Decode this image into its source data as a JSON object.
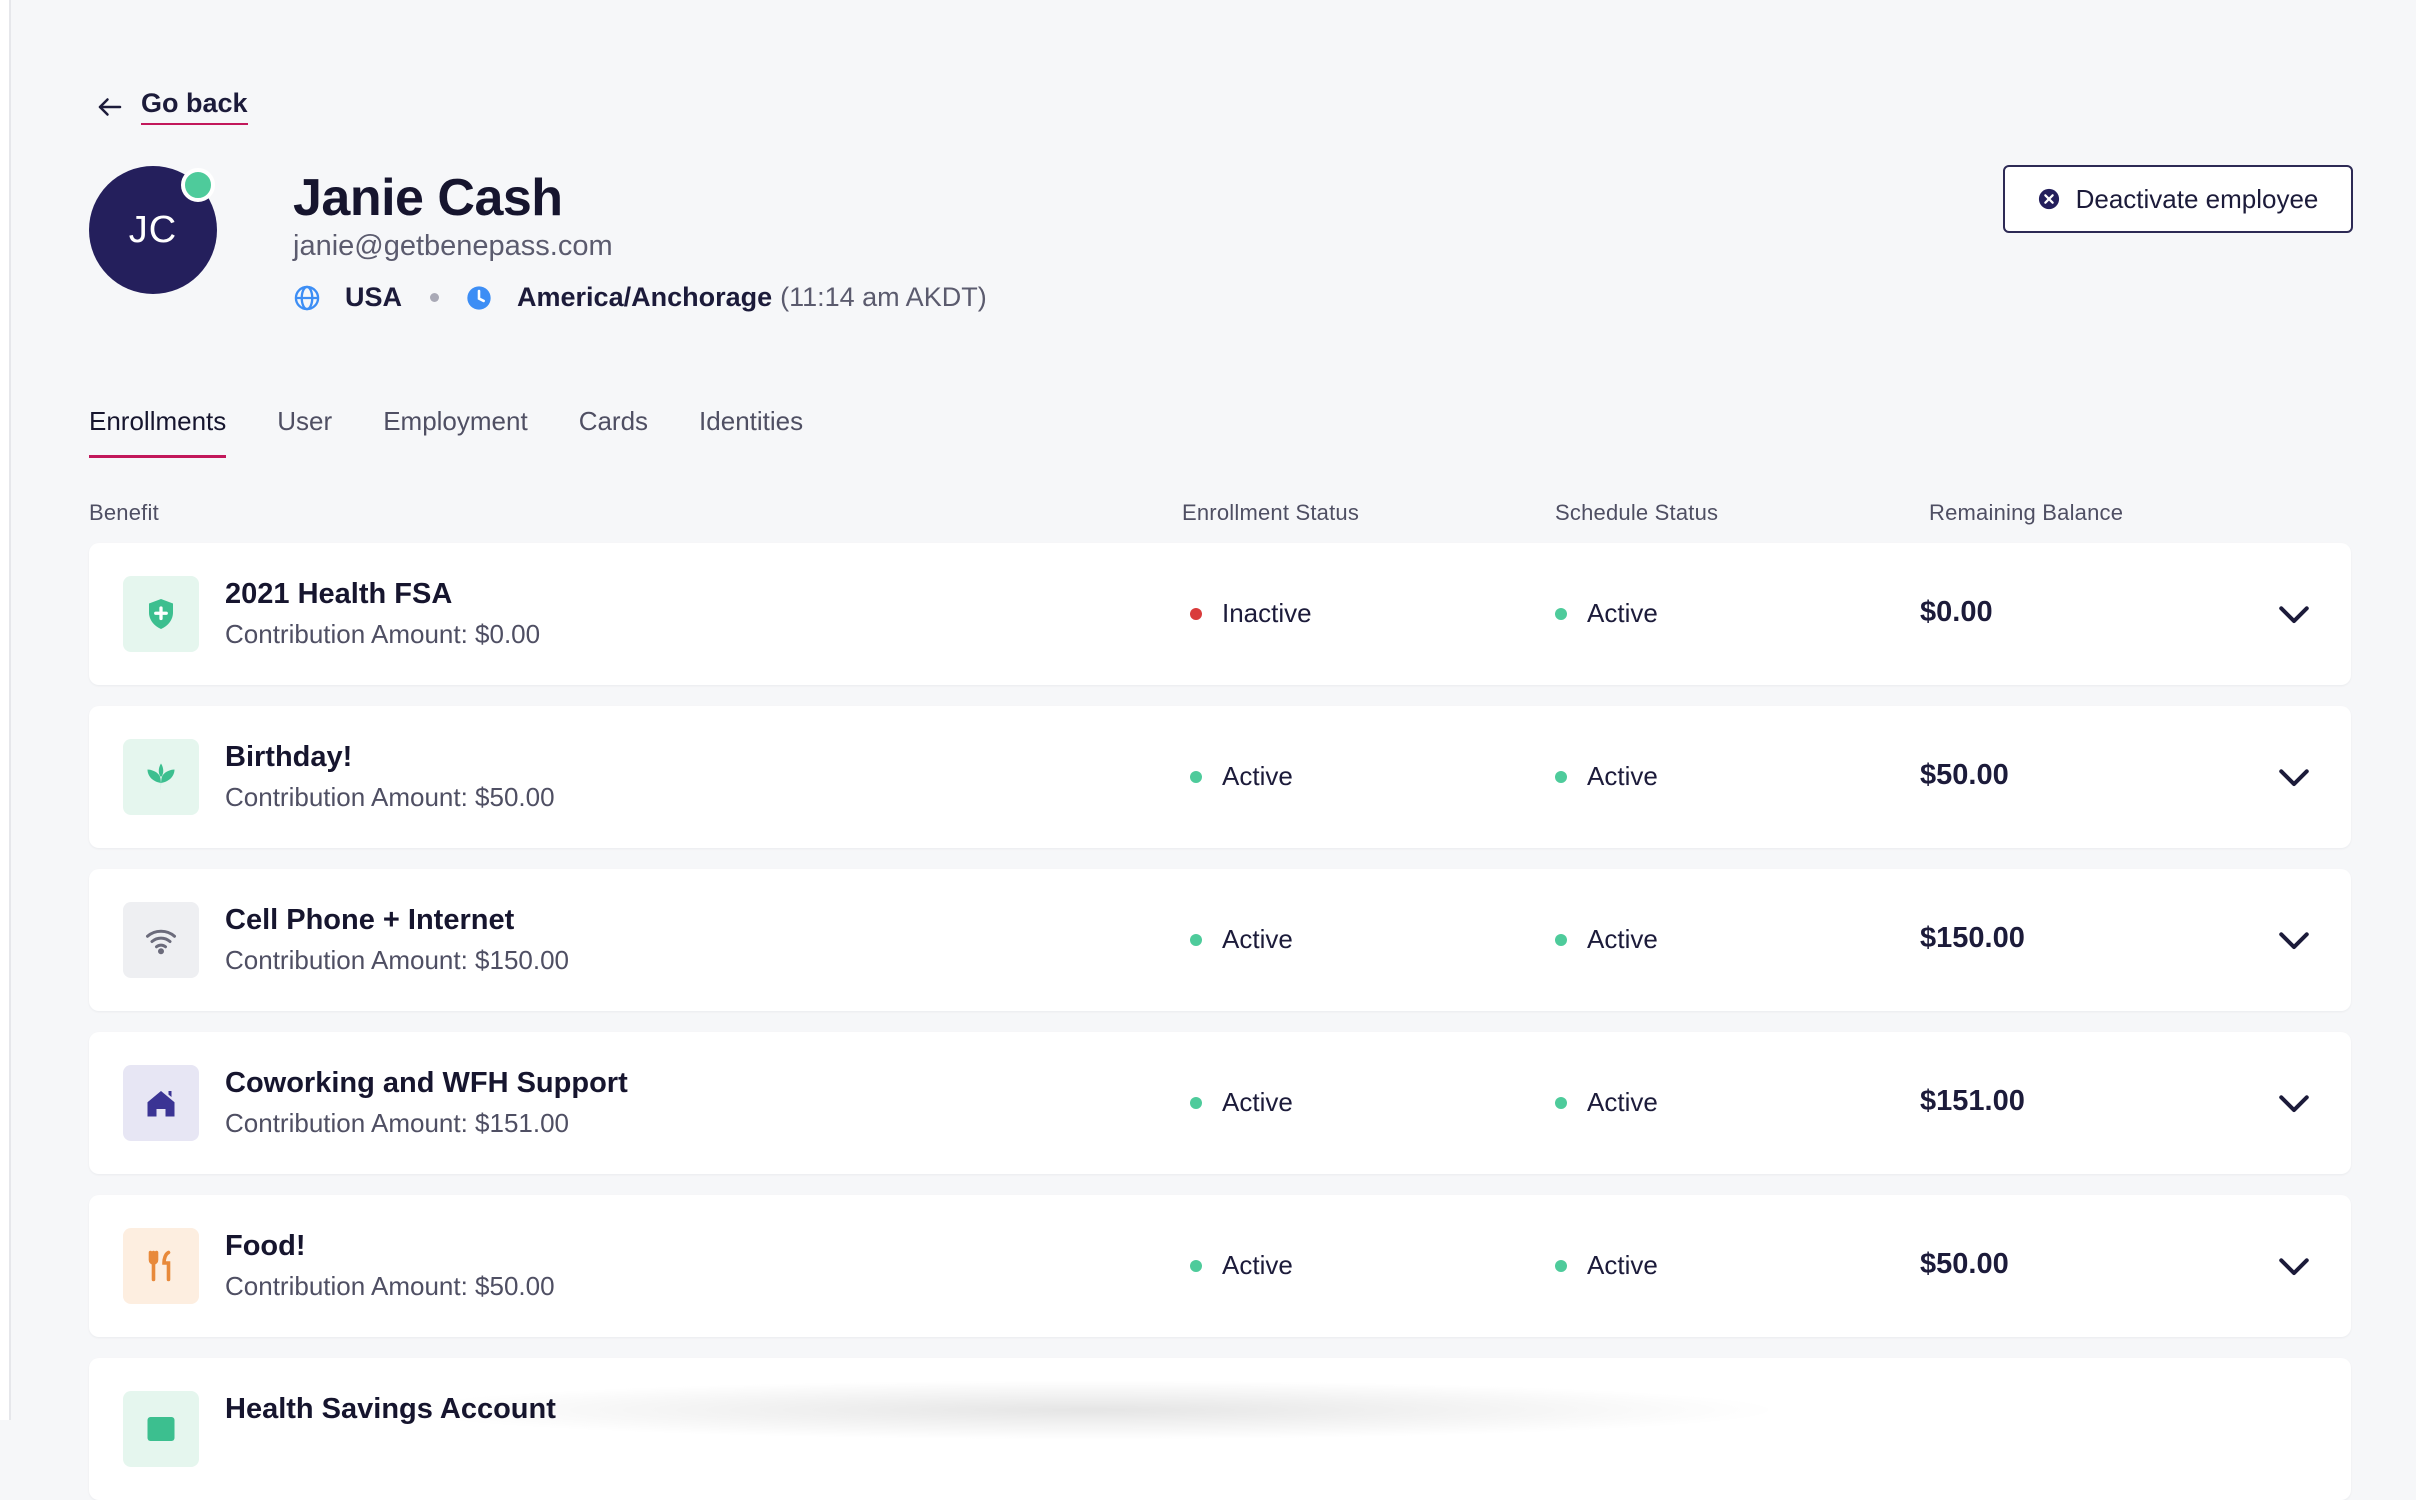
{
  "nav": {
    "back_label": "Go back"
  },
  "employee": {
    "initials": "JC",
    "name": "Janie Cash",
    "email": "janie@getbenepass.com",
    "country": "USA",
    "timezone": "America/Anchorage",
    "local_time": "(11:14 am AKDT)",
    "presence": "online"
  },
  "actions": {
    "deactivate_label": "Deactivate employee"
  },
  "tabs": [
    {
      "label": "Enrollments",
      "active": true
    },
    {
      "label": "User",
      "active": false
    },
    {
      "label": "Employment",
      "active": false
    },
    {
      "label": "Cards",
      "active": false
    },
    {
      "label": "Identities",
      "active": false
    }
  ],
  "table": {
    "columns": {
      "benefit": "Benefit",
      "enrollment_status": "Enrollment Status",
      "schedule_status": "Schedule Status",
      "remaining_balance": "Remaining Balance"
    },
    "rows": [
      {
        "title": "2021 Health FSA",
        "contribution": "Contribution Amount: $0.00",
        "enrollment_status": "Inactive",
        "schedule_status": "Active",
        "balance": "$0.00",
        "icon": "shield-plus-icon"
      },
      {
        "title": "Birthday!",
        "contribution": "Contribution Amount: $50.00",
        "enrollment_status": "Active",
        "schedule_status": "Active",
        "balance": "$50.00",
        "icon": "sprout-icon"
      },
      {
        "title": "Cell Phone + Internet",
        "contribution": "Contribution Amount: $150.00",
        "enrollment_status": "Active",
        "schedule_status": "Active",
        "balance": "$150.00",
        "icon": "wifi-icon"
      },
      {
        "title": "Coworking and WFH Support",
        "contribution": "Contribution Amount: $151.00",
        "enrollment_status": "Active",
        "schedule_status": "Active",
        "balance": "$151.00",
        "icon": "home-icon"
      },
      {
        "title": "Food!",
        "contribution": "Contribution Amount: $50.00",
        "enrollment_status": "Active",
        "schedule_status": "Active",
        "balance": "$50.00",
        "icon": "utensils-icon"
      },
      {
        "title": "Health Savings Account",
        "contribution": "",
        "enrollment_status": "",
        "schedule_status": "",
        "balance": "",
        "icon": "bank-icon"
      }
    ]
  },
  "colors": {
    "brand_dark": "#241f5c",
    "accent_underline": "#c2185b",
    "status_active": "#4ecb9b",
    "status_inactive": "#d93b3b",
    "icon_blue": "#3d8ef5"
  }
}
